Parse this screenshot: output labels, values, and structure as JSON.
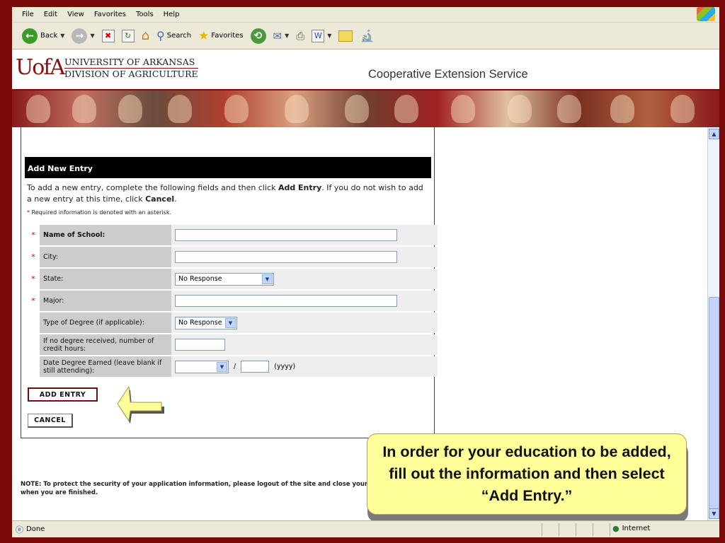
{
  "menu": [
    "File",
    "Edit",
    "View",
    "Favorites",
    "Tools",
    "Help"
  ],
  "toolbar": {
    "back": "Back",
    "search": "Search",
    "favorites": "Favorites"
  },
  "header": {
    "logo": "UofA",
    "university": "UNIVERSITY OF ARKANSAS",
    "division": "DIVISION OF AGRICULTURE",
    "service": "Cooperative Extension Service"
  },
  "form": {
    "title": "Add New Entry",
    "intro_pre": "To add a new entry, complete the following fields and then click ",
    "intro_add": "Add Entry",
    "intro_mid": ". If you do not wish to add a new entry at this time, click ",
    "intro_cancel": "Cancel",
    "intro_end": ".",
    "required_note": "Required information is denoted with an asterisk.",
    "fields": {
      "school": "Name of School:",
      "city": "City:",
      "state": "State:",
      "state_value": "No Response",
      "major": "Major:",
      "degree_type": "Type of Degree (if applicable):",
      "degree_value": "No Response",
      "credit_hours": "If no degree received, number of credit hours:",
      "date_earned": "Date Degree Earned (leave blank if still attending):",
      "date_sep": "/",
      "year_hint": "(yyyy)"
    },
    "add_button": "ADD ENTRY",
    "cancel_button": "CANCEL"
  },
  "note": "NOTE:   To protect the security of your application information, please logout of the site and close your browser window when you are finished.",
  "callout": "In order for your education to be added, fill out the information and then select “Add Entry.”",
  "status": {
    "left": "Done",
    "zone": "Internet"
  }
}
